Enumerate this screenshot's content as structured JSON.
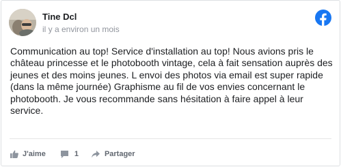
{
  "post": {
    "author": "Tine Dcl",
    "timestamp": "il y a environ un mois",
    "avatar_icon": "profile-photo",
    "brand_icon": "facebook-logo-icon",
    "brand_color": "#1877f2",
    "review_text": "Communication au top! Service d'installation au top! Nous avions pris le château princesse et le photobooth vintage, cela à fait sensation auprès des jeunes et des moins jeunes. L envoi des photos via email est super rapide (dans la même journée) Graphisme au fil de vos envies concernant le photobooth. Je vous recommande sans hésitation à faire appel à leur service."
  },
  "actions": {
    "like_label": "J'aime",
    "like_icon": "thumbs-up-icon",
    "comment_count": "1",
    "comment_icon": "comment-icon",
    "share_label": "Partager",
    "share_icon": "share-arrow-icon"
  }
}
